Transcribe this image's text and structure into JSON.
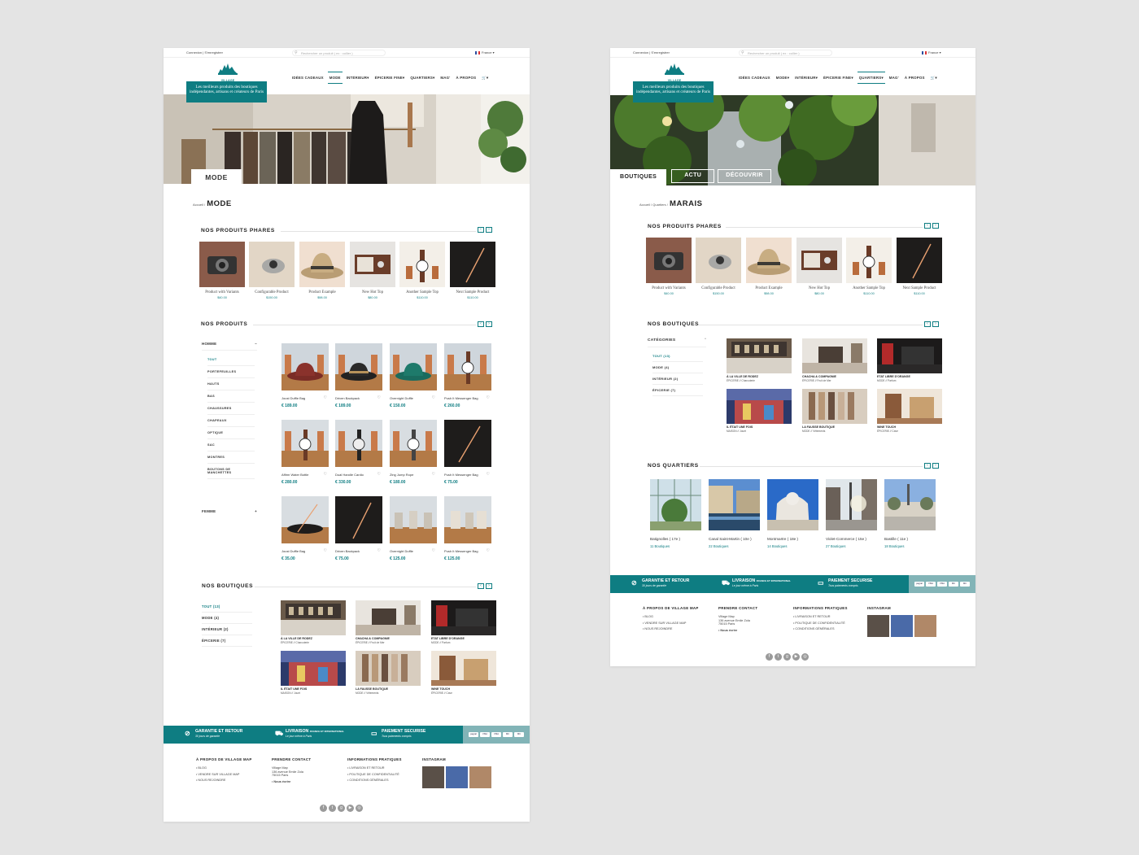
{
  "page_left": {
    "topbar": {
      "account": "Connexion  |  S'enregistrer",
      "search_placeholder": "Rechercher un produit ( ex : collier )",
      "language": "France"
    },
    "logo_text": "VILLAGE MAP",
    "tagline": "Les meilleurs produits des boutiques indépendantes, artisans et créateurs de Paris",
    "nav": [
      "IDÉES CADEAUX",
      "MODE",
      "INTÉRIEUR",
      "ÉPICERIE FINE",
      "QUARTIERS",
      "MAG'",
      "À PROPOS"
    ],
    "hero_label": "MODE",
    "breadcrumb": {
      "path": "Accueil /",
      "current": "MODE"
    },
    "featured": {
      "title": "NOS  PRODUITS  PHARES",
      "items": [
        {
          "name": "Product with Variants",
          "price": "$40.00"
        },
        {
          "name": "Configurable Product",
          "price": "$150.00"
        },
        {
          "name": "Product Example",
          "price": "$98.00"
        },
        {
          "name": "New Hot Top",
          "price": "$80.00"
        },
        {
          "name": "Another Sample Top",
          "price": "$110.00"
        },
        {
          "name": "Next Sample Product",
          "price": "$110.00"
        }
      ]
    },
    "products": {
      "title": "NOS  PRODUITS",
      "sidebar": {
        "homme": "HOMME",
        "items": [
          "TOUT",
          "PORTEFEUILLES",
          "HAUTS",
          "BAS",
          "CHAUSSURES",
          "CHAPEAUX",
          "OPTIQUE",
          "SAC",
          "MONTRES",
          "BOUTONS DE MANCHETTES"
        ],
        "femme": "FEMME"
      },
      "items": [
        {
          "name": "Joust Duffle Bag",
          "price": "€ 189.00"
        },
        {
          "name": "Driven Backpack",
          "price": "€ 189.00"
        },
        {
          "name": "Overnight Duffle",
          "price": "€ 150.00"
        },
        {
          "name": "Push It Messenger Bag",
          "price": "€ 260.00"
        },
        {
          "name": "Affirm Water Bottle",
          "price": "€ 280.00"
        },
        {
          "name": "Dual Handle Cardio",
          "price": "€ 330.00"
        },
        {
          "name": "Zing Jump Rope",
          "price": "€ 180.00"
        },
        {
          "name": "Push It Messenger Bag",
          "price": "€ 75.00"
        },
        {
          "name": "Joust Duffle Bag",
          "price": "€ 35.00"
        },
        {
          "name": "Driven Backpack",
          "price": "€ 75.00"
        },
        {
          "name": "Overnight Duffle",
          "price": "€ 125.00"
        },
        {
          "name": "Push It Messenger Bag",
          "price": "€ 125.00"
        }
      ]
    },
    "boutiques": {
      "title": "NOS  BOUTIQUES",
      "filters": [
        "TOUT (13)",
        "MODE (4)",
        "INTÉRIEUR (2)",
        "ÉPICERIE (7)"
      ],
      "items": [
        {
          "name": "À LA VILLE DE RODEZ",
          "sub": "ÉPICERIE // Charcuterie"
        },
        {
          "name": "CHACHA & COMPAGNIE",
          "sub": "ÉPICERIE // Fruit de Mer"
        },
        {
          "name": "ETAT LIBRE D'ORANGE",
          "sub": "MODE // Parfum"
        },
        {
          "name": "IL ÉTAIT UNE FOIS",
          "sub": "MAISON // Jouet"
        },
        {
          "name": "LA FAUSSE BOUTIQUE",
          "sub": "MODE // Vêtements"
        },
        {
          "name": "WINE TOUCH",
          "sub": "ÉPICERIE // Cave"
        }
      ]
    },
    "strip": {
      "g1": "GARANTIE ET RETOUR",
      "g1s": "30 jours de garantie",
      "g2": "LIVRAISON",
      "g2x": "FRANCE ET INTERNATIONAL",
      "g2s": "Le jour même à Paris",
      "g3": "PAIEMENT SECURISE",
      "g3s": "Tous paiements compris",
      "pay": [
        "paypal",
        "VISA",
        "VISA",
        "MC",
        "MC"
      ]
    },
    "footer": {
      "c1": {
        "title": "À PROPOS DE VILLAGE MAP",
        "links": [
          "• BLOG",
          "• VENDRE SUR VILLAGE MAP",
          "• NOUS REJOINDRE"
        ]
      },
      "c2": {
        "title": "PRENDRE CONTACT",
        "lines": [
          "Village Map",
          "136 avenue Emile Zola",
          "75015 Paris"
        ],
        "cta": "• Nous écrire"
      },
      "c3": {
        "title": "INFORMATIONS PRATIQUES",
        "links": [
          "• LIVRAISON ET RETOUR",
          "• POLITIQUE DE CONFIDENTIALITÉ",
          "• CONDITIONS GÉNÉRALES"
        ]
      },
      "c4": {
        "title": "INSTAGRAM"
      }
    },
    "social": [
      "f",
      "t",
      "g",
      "▶",
      "◎"
    ]
  },
  "page_right": {
    "topbar": {
      "account": "Connexion  |  S'enregistrer",
      "search_placeholder": "Rechercher un produit ( ex : collier )",
      "language": "France"
    },
    "logo_text": "VILLAGE MAP",
    "tagline": "Les meilleurs produits des boutiques indépendantes, artisans et créateurs de Paris",
    "nav": [
      "IDÉES CADEAUX",
      "MODE",
      "INTÉRIEUR",
      "ÉPICERIE FINE",
      "QUARTIERS",
      "MAG'",
      "À PROPOS"
    ],
    "tabs": [
      "BOUTIQUES",
      "ACTU",
      "DÉCOUVRIR"
    ],
    "breadcrumb": {
      "path": "Accueil / Quartiers /",
      "current": "MARAIS"
    },
    "featured": {
      "title": "NOS  PRODUITS  PHARES",
      "items": [
        {
          "name": "Product with Variants",
          "price": "$40.00"
        },
        {
          "name": "Configurable Product",
          "price": "$150.00"
        },
        {
          "name": "Product Example",
          "price": "$98.00"
        },
        {
          "name": "New Hot Top",
          "price": "$80.00"
        },
        {
          "name": "Another Sample Top",
          "price": "$110.00"
        },
        {
          "name": "Next Sample Product",
          "price": "$110.00"
        }
      ]
    },
    "boutiques": {
      "title": "NOS BOUTIQUES",
      "cat_title": "CATÉGORIES",
      "filters": [
        "TOUT (13)",
        "MODE (4)",
        "INTÉRIEUR (2)",
        "ÉPICERIE (7)"
      ],
      "items": [
        {
          "name": "À LA VILLE DE RODEZ",
          "sub": "ÉPICERIE // Charcuterie"
        },
        {
          "name": "CHACHA & COMPAGNIE",
          "sub": "ÉPICERIE // Fruit de Mer"
        },
        {
          "name": "ETAT LIBRE D'ORANGE",
          "sub": "MODE // Parfum"
        },
        {
          "name": "IL ÉTAIT UNE FOIS",
          "sub": "MAISON // Jouet"
        },
        {
          "name": "LA FAUSSE BOUTIQUE",
          "sub": "MODE // Vêtements"
        },
        {
          "name": "WINE TOUCH",
          "sub": "ÉPICERIE // Cave"
        }
      ]
    },
    "quartiers": {
      "title": "NOS QUARTIERS",
      "items": [
        {
          "name": "Batignolles ( 17e )",
          "sub": "11 Boutiques"
        },
        {
          "name": "Canal Saint-Martin ( 10e )",
          "sub": "22 Boutiques"
        },
        {
          "name": "Montmartre ( 18e )",
          "sub": "14 Boutiques"
        },
        {
          "name": "Violet-Commerce ( 15e )",
          "sub": "27 Boutiques"
        },
        {
          "name": "Bastille ( 11e )",
          "sub": "18 Boutiques"
        }
      ]
    },
    "strip": {
      "g1": "GARANTIE ET RETOUR",
      "g1s": "30 jours de garantie",
      "g2": "LIVRAISON",
      "g2x": "FRANCE ET INTERNATIONAL",
      "g2s": "Le jour même à Paris",
      "g3": "PAIEMENT SECURISE",
      "g3s": "Tous paiements compris",
      "pay": [
        "paypal",
        "VISA",
        "VISA",
        "MC",
        "MC"
      ]
    },
    "footer": {
      "c1": {
        "title": "À PROPOS DE VILLAGE MAP",
        "links": [
          "• BLOG",
          "• VENDRE SUR VILLAGE MAP",
          "• NOUS REJOINDRE"
        ]
      },
      "c2": {
        "title": "PRENDRE CONTACT",
        "lines": [
          "Village Map",
          "136 avenue Emile Zola",
          "75015 Paris"
        ],
        "cta": "• Nous écrire"
      },
      "c3": {
        "title": "INFORMATIONS PRATIQUES",
        "links": [
          "• LIVRAISON ET RETOUR",
          "• POLITIQUE DE CONFIDENTIALITÉ",
          "• CONDITIONS GÉNÉRALES"
        ]
      },
      "c4": {
        "title": "INSTAGRAM"
      }
    },
    "social": [
      "f",
      "t",
      "g",
      "▶",
      "◎"
    ]
  },
  "colors": {
    "accent": "#0e7d82",
    "strip_light": "#82b4b7",
    "background": "#e4e4e4"
  }
}
